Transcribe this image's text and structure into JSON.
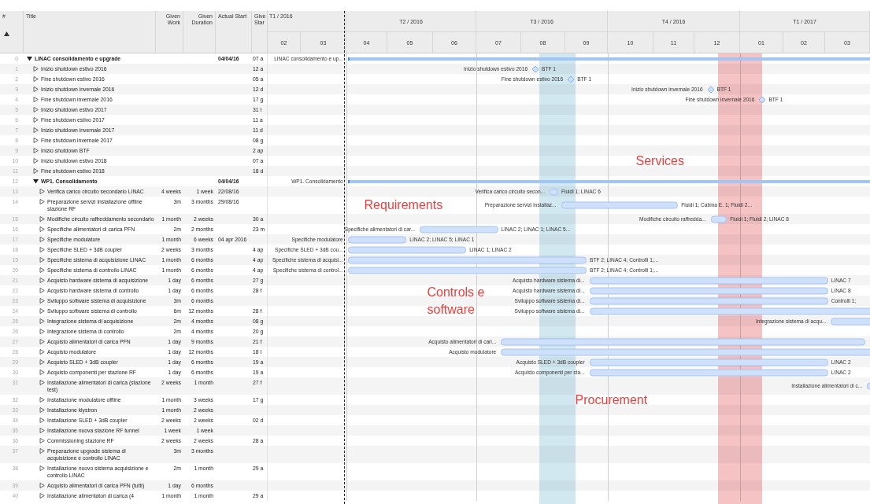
{
  "columns": [
    "#",
    "Title",
    "Given Work",
    "Given Duration",
    "Actual Start",
    "Give Star"
  ],
  "timeline": {
    "quarters": [
      {
        "label": "T1 / 2016",
        "months": [
          "02",
          "03"
        ]
      },
      {
        "label": "T2 / 2016",
        "months": [
          "04",
          "05",
          "06"
        ]
      },
      {
        "label": "T3 / 2016",
        "months": [
          "07",
          "08",
          "09"
        ]
      },
      {
        "label": "T4 / 2016",
        "months": [
          "10",
          "11",
          "12"
        ]
      },
      {
        "label": "T1 / 2017",
        "months": [
          "01",
          "02",
          "03"
        ]
      }
    ]
  },
  "highlight_bands": [
    {
      "color": "#d2e8f1"
    },
    {
      "color": "#f6c3c5"
    }
  ],
  "rows": [
    {
      "num": "0",
      "title": "LINAC consolidamento e upgrade",
      "kind": "group",
      "expanded": true,
      "actual_start": "04/04/16",
      "given_start": "07 a",
      "gantt": {
        "kind": "summary",
        "label_before": "LINAC consolidamento e up..."
      },
      "children": [
        {
          "num": "1",
          "title": "Inizio shutdown estivo 2016",
          "kind": "task",
          "expanded": false,
          "given_start": "12 a",
          "gantt": {
            "kind": "milestone",
            "label_before": "Inizio shutdown estivo 2016",
            "label_after": "BTF 1"
          }
        },
        {
          "num": "2",
          "title": "Fine shutdown estivo 2016",
          "kind": "task",
          "expanded": false,
          "given_start": "05 a",
          "gantt": {
            "kind": "milestone",
            "label_before": "Fine shutdown estivo 2016",
            "label_after": "BTF 1"
          }
        },
        {
          "num": "3",
          "title": "Inizio shutdown invernale 2016",
          "kind": "task",
          "expanded": false,
          "given_start": "12 d",
          "gantt": {
            "kind": "milestone",
            "label_before": "Inizio shutdown invernale 2016",
            "label_after": "BTF 1"
          }
        },
        {
          "num": "4",
          "title": "Fine shutdown invernale 2016",
          "kind": "task",
          "expanded": false,
          "given_start": "17 g",
          "gantt": {
            "kind": "milestone",
            "label_before": "Fine shutdown invernale 2016",
            "label_after": "BTF 1"
          }
        },
        {
          "num": "5",
          "title": "Inizio shutdown estivo 2017",
          "kind": "task",
          "expanded": false,
          "given_start": "31 l"
        },
        {
          "num": "6",
          "title": "Fine shutdown estivo 2017",
          "kind": "task",
          "expanded": false,
          "given_start": "11 a"
        },
        {
          "num": "7",
          "title": "Inizio shutdown invernale 2017",
          "kind": "task",
          "expanded": false,
          "given_start": "11 d"
        },
        {
          "num": "8",
          "title": "Fine shutdown invernale 2017",
          "kind": "task",
          "expanded": false,
          "given_start": "08 g"
        },
        {
          "num": "9",
          "title": "Inizio shutdown BTF",
          "kind": "task",
          "expanded": false,
          "given_start": "2 ap"
        },
        {
          "num": "10",
          "title": "Inizio shutdown estivo 2018",
          "kind": "task",
          "expanded": false,
          "given_start": "07 a",
          "annotation": {
            "text": "Services"
          }
        },
        {
          "num": "11",
          "title": "Fine shutdown estivo 2018",
          "kind": "task",
          "expanded": false,
          "given_start": "18 d"
        },
        {
          "num": "12",
          "title": "WP1. Consolidamento",
          "kind": "group",
          "expanded": true,
          "actual_start": "04/04/16",
          "gantt": {
            "kind": "summary",
            "label_before": "WP1. Consolidamento"
          },
          "children": [
            {
              "num": "13",
              "title": "Verifica carico circuito secondario LINAC",
              "kind": "task",
              "expanded": false,
              "work": "4 weeks",
              "duration": "1 week",
              "actual_start": "22/08/16",
              "gantt": {
                "kind": "bar",
                "label_before": "Verifica carico circuito secon...",
                "label_after": "Fluidi 1; LINAC 6"
              }
            },
            {
              "num": "14",
              "title": "Preparazione servizi installazione offline stazione RF",
              "kind": "task",
              "expanded": false,
              "work": "3m",
              "duration": "3 months",
              "actual_start": "29/08/16",
              "gantt": {
                "kind": "bar",
                "label_before": "Preparazione servizi installaz...",
                "label_after": "Fluidi 1; Cabina E. 1; Fluidi 2..."
              },
              "annotation": {
                "text": "Requirements"
              }
            },
            {
              "num": "15",
              "title": "Modifiche circuito raffreddamento secondario",
              "kind": "task",
              "expanded": false,
              "work": "1 month",
              "duration": "2 weeks",
              "given_start": "30 a",
              "gantt": {
                "kind": "bar",
                "label_before": "Modifiche circuito raffredda...",
                "label_after": "Fluidi 1; Fluidi 2; LINAC 8"
              }
            },
            {
              "num": "16",
              "title": "Specifiche alimentatori di carica PFN",
              "kind": "task",
              "expanded": false,
              "work": "2m",
              "duration": "2 months",
              "given_start": "23 m",
              "gantt": {
                "kind": "bar",
                "label_before": "Specifiche alimentatori di car...",
                "label_after": "LINAC 2; LINAC 1; LINAC 5..."
              }
            },
            {
              "num": "17",
              "title": "Specifiche modulatore",
              "kind": "task",
              "expanded": false,
              "work": "1 month",
              "duration": "6 weeks",
              "actual_start": "04 apr 2016",
              "gantt": {
                "kind": "bar",
                "label_before": "Specifiche modulatore",
                "label_after": "LINAC 2; LINAC 5; LINAC 1"
              }
            },
            {
              "num": "18",
              "title": "Specifiche SLED + 3dB coupler",
              "kind": "task",
              "expanded": false,
              "work": "2 weeks",
              "duration": "3 months",
              "given_start": "4 ap",
              "gantt": {
                "kind": "bar",
                "label_before": "Specifiche SLED + 3dB cou...",
                "label_after": "LINAC 1; LINAC 2"
              }
            },
            {
              "num": "19",
              "title": "Specifiche sistema di acquisizione LINAC",
              "kind": "task",
              "expanded": false,
              "work": "1 month",
              "duration": "6 months",
              "given_start": "4 ap",
              "gantt": {
                "kind": "bar",
                "label_before": "Specifiche sistema di acquisi...",
                "label_after": "BTF 2; LINAC 4; Controlli 1;..."
              }
            },
            {
              "num": "20",
              "title": "Specifiche sistema di controllo LINAC",
              "kind": "task",
              "expanded": false,
              "work": "1 month",
              "duration": "6 months",
              "given_start": "4 ap",
              "gantt": {
                "kind": "bar",
                "label_before": "Specifiche sistema di control...",
                "label_after": "BTF 2; LINAC 4; Controlli 1;..."
              }
            },
            {
              "num": "21",
              "title": "Acquisto hardware sistema di acquisizione",
              "kind": "task",
              "expanded": false,
              "work": "1 day",
              "duration": "6 months",
              "given_start": "27 g",
              "gantt": {
                "kind": "bar",
                "label_before": "Acquisto hardware sistema di...",
                "label_after": "LINAC 7"
              }
            },
            {
              "num": "22",
              "title": "Acquisto hardware sistema di controllo",
              "kind": "task",
              "expanded": false,
              "work": "1 day",
              "duration": "6 months",
              "given_start": "28 f",
              "gantt": {
                "kind": "bar",
                "label_before": "Acquisto hardware sistema di...",
                "label_after": "LINAC 8"
              }
            },
            {
              "num": "23",
              "title": "Sviluppo software sistema di acquisizione",
              "kind": "task",
              "expanded": false,
              "work": "3m",
              "duration": "6 months",
              "gantt": {
                "kind": "bar",
                "label_before": "Sviluppo software sistema di...",
                "label_after": "Controlli 1;"
              },
              "annotation": {
                "text": "Controls e software"
              }
            },
            {
              "num": "24",
              "title": "Sviluppo software sistema di controllo",
              "kind": "task",
              "expanded": false,
              "work": "6m",
              "duration": "12 months",
              "given_start": "28 f",
              "gantt": {
                "kind": "bar",
                "label_before": "Sviluppo software sistema di..."
              }
            },
            {
              "num": "25",
              "title": "Integrazione sistema di acquisizione",
              "kind": "task",
              "expanded": false,
              "work": "2m",
              "duration": "4 months",
              "given_start": "08 g",
              "gantt": {
                "kind": "bar",
                "label_before": "Integrazione sistema di acqu..."
              }
            },
            {
              "num": "26",
              "title": "Integrazione sistema di controllo",
              "kind": "task",
              "expanded": false,
              "work": "2m",
              "duration": "4 months",
              "given_start": "20 g"
            },
            {
              "num": "27",
              "title": "Acquisto alimentatori di carica PFN",
              "kind": "task",
              "expanded": false,
              "work": "1 day",
              "duration": "9 months",
              "given_start": "21 f",
              "gantt": {
                "kind": "bar",
                "label_before": "Acquisto alimentatori di cari..."
              }
            },
            {
              "num": "28",
              "title": "Acquisto modulatore",
              "kind": "task",
              "expanded": false,
              "work": "1 day",
              "duration": "12 months",
              "given_start": "18 l",
              "gantt": {
                "kind": "bar",
                "label_before": "Acquisto modulatore"
              }
            },
            {
              "num": "29",
              "title": "Acquisto SLED + 3dB coupler",
              "kind": "task",
              "expanded": false,
              "work": "1 day",
              "duration": "6 months",
              "given_start": "19 a",
              "gantt": {
                "kind": "bar",
                "label_before": "Acquisto SLED + 3dB coupler",
                "label_after": "LINAC 2"
              }
            },
            {
              "num": "30",
              "title": "Acquisto componenti per stazione RF",
              "kind": "task",
              "expanded": false,
              "work": "1 day",
              "duration": "6 months",
              "given_start": "19 a",
              "gantt": {
                "kind": "bar",
                "label_before": "Acquisto componenti per sta...",
                "label_after": "LINAC 2"
              }
            },
            {
              "num": "31",
              "title": "Installazione alimentatori di carica (stazione test)",
              "kind": "task",
              "expanded": false,
              "work": "2 weeks",
              "duration": "1 month",
              "given_start": "27 f",
              "gantt": {
                "kind": "bar",
                "label_before": "Installazione alimentatori di c..."
              }
            },
            {
              "num": "32",
              "title": "Installazione modulatore offline",
              "kind": "task",
              "expanded": false,
              "work": "1 month",
              "duration": "3 weeks",
              "given_start": "17 g",
              "annotation": {
                "text": "Procurement"
              }
            },
            {
              "num": "33",
              "title": "Installazione klystron",
              "kind": "task",
              "expanded": false,
              "work": "1 month",
              "duration": "2 weeks"
            },
            {
              "num": "34",
              "title": "Installazione SLED + 3dB coupler",
              "kind": "task",
              "expanded": false,
              "work": "2 weeks",
              "duration": "2 weeks",
              "given_start": "02 d"
            },
            {
              "num": "35",
              "title": "Installazione nuova stazione RF tunnel",
              "kind": "task",
              "expanded": false,
              "work": "1 week",
              "duration": "1 week"
            },
            {
              "num": "36",
              "title": "Commissioning stazione RF",
              "kind": "task",
              "expanded": false,
              "work": "2 weeks",
              "duration": "2 weeks",
              "given_start": "28 a"
            },
            {
              "num": "37",
              "title": "Preparazione upgrade sistema di acquisizione e controllo LINAC",
              "kind": "task",
              "expanded": false,
              "work": "3m",
              "duration": "3 months"
            },
            {
              "num": "38",
              "title": "Installazione nuovo sistema acquisizione e controllo LINAC",
              "kind": "task",
              "expanded": false,
              "work": "2m",
              "duration": "1 month",
              "given_start": "29 a"
            },
            {
              "num": "39",
              "title": "Acquisto alimentatori di carica PFN (tutti)",
              "kind": "task",
              "expanded": false,
              "work": "1 day",
              "duration": "6 months"
            },
            {
              "num": "40",
              "title": "Installazione alimentatori di carica (4",
              "kind": "task",
              "expanded": false,
              "work": "1 month",
              "duration": "1 month",
              "given_start": "29 a"
            }
          ]
        }
      ]
    }
  ]
}
